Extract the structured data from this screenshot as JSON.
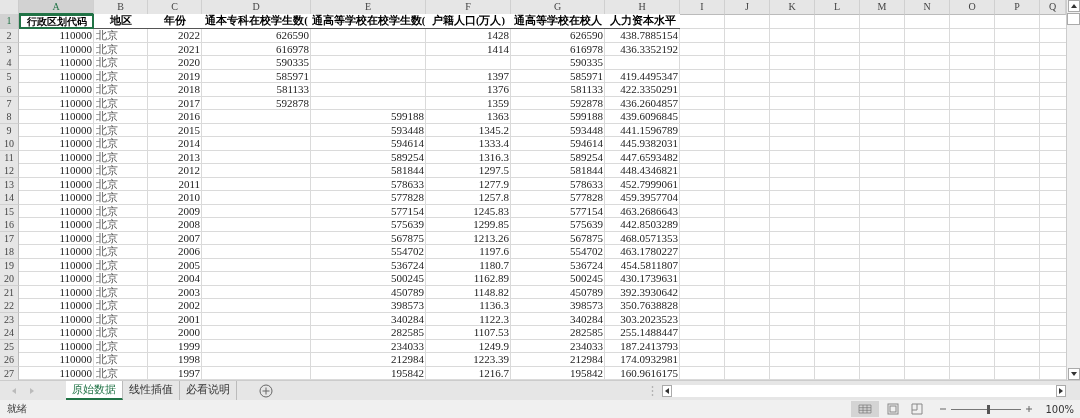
{
  "columns": [
    {
      "label": "A",
      "selected": true
    },
    {
      "label": "B",
      "selected": false
    },
    {
      "label": "C",
      "selected": false
    },
    {
      "label": "D",
      "selected": false
    },
    {
      "label": "E",
      "selected": false
    },
    {
      "label": "F",
      "selected": false
    },
    {
      "label": "G",
      "selected": false
    },
    {
      "label": "H",
      "selected": false
    },
    {
      "label": "I",
      "selected": false
    },
    {
      "label": "J",
      "selected": false
    },
    {
      "label": "K",
      "selected": false
    },
    {
      "label": "L",
      "selected": false
    },
    {
      "label": "M",
      "selected": false
    },
    {
      "label": "N",
      "selected": false
    },
    {
      "label": "O",
      "selected": false
    },
    {
      "label": "P",
      "selected": false
    },
    {
      "label": "Q",
      "selected": false
    }
  ],
  "rows": [
    {
      "number": "1",
      "selected": true,
      "cells": [
        "行政区划代码",
        "地区",
        "年份",
        "通本专科在校学生数(",
        "通高等学校在校学生数(",
        "户籍人口(万人)",
        "通高等学校在校人",
        "人力资本水平"
      ]
    },
    {
      "number": "2",
      "selected": false,
      "cells": [
        "110000",
        "北京",
        "2022",
        "626590",
        null,
        "1428",
        "626590",
        "438.7885154"
      ]
    },
    {
      "number": "3",
      "selected": false,
      "cells": [
        "110000",
        "北京",
        "2021",
        "616978",
        null,
        "1414",
        "616978",
        "436.3352192"
      ]
    },
    {
      "number": "4",
      "selected": false,
      "cells": [
        "110000",
        "北京",
        "2020",
        "590335",
        null,
        null,
        "590335",
        null
      ]
    },
    {
      "number": "5",
      "selected": false,
      "cells": [
        "110000",
        "北京",
        "2019",
        "585971",
        null,
        "1397",
        "585971",
        "419.4495347"
      ]
    },
    {
      "number": "6",
      "selected": false,
      "cells": [
        "110000",
        "北京",
        "2018",
        "581133",
        null,
        "1376",
        "581133",
        "422.3350291"
      ]
    },
    {
      "number": "7",
      "selected": false,
      "cells": [
        "110000",
        "北京",
        "2017",
        "592878",
        null,
        "1359",
        "592878",
        "436.2604857"
      ]
    },
    {
      "number": "8",
      "selected": false,
      "cells": [
        "110000",
        "北京",
        "2016",
        null,
        "599188",
        "1363",
        "599188",
        "439.6096845"
      ]
    },
    {
      "number": "9",
      "selected": false,
      "cells": [
        "110000",
        "北京",
        "2015",
        null,
        "593448",
        "1345.2",
        "593448",
        "441.1596789"
      ]
    },
    {
      "number": "10",
      "selected": false,
      "cells": [
        "110000",
        "北京",
        "2014",
        null,
        "594614",
        "1333.4",
        "594614",
        "445.9382031"
      ]
    },
    {
      "number": "11",
      "selected": false,
      "cells": [
        "110000",
        "北京",
        "2013",
        null,
        "589254",
        "1316.3",
        "589254",
        "447.6593482"
      ]
    },
    {
      "number": "12",
      "selected": false,
      "cells": [
        "110000",
        "北京",
        "2012",
        null,
        "581844",
        "1297.5",
        "581844",
        "448.4346821"
      ]
    },
    {
      "number": "13",
      "selected": false,
      "cells": [
        "110000",
        "北京",
        "2011",
        null,
        "578633",
        "1277.9",
        "578633",
        "452.7999061"
      ]
    },
    {
      "number": "14",
      "selected": false,
      "cells": [
        "110000",
        "北京",
        "2010",
        null,
        "577828",
        "1257.8",
        "577828",
        "459.3957704"
      ]
    },
    {
      "number": "15",
      "selected": false,
      "cells": [
        "110000",
        "北京",
        "2009",
        null,
        "577154",
        "1245.83",
        "577154",
        "463.2686643"
      ]
    },
    {
      "number": "16",
      "selected": false,
      "cells": [
        "110000",
        "北京",
        "2008",
        null,
        "575639",
        "1299.85",
        "575639",
        "442.8503289"
      ]
    },
    {
      "number": "17",
      "selected": false,
      "cells": [
        "110000",
        "北京",
        "2007",
        null,
        "567875",
        "1213.26",
        "567875",
        "468.0571353"
      ]
    },
    {
      "number": "18",
      "selected": false,
      "cells": [
        "110000",
        "北京",
        "2006",
        null,
        "554702",
        "1197.6",
        "554702",
        "463.1780227"
      ]
    },
    {
      "number": "19",
      "selected": false,
      "cells": [
        "110000",
        "北京",
        "2005",
        null,
        "536724",
        "1180.7",
        "536724",
        "454.5811807"
      ]
    },
    {
      "number": "20",
      "selected": false,
      "cells": [
        "110000",
        "北京",
        "2004",
        null,
        "500245",
        "1162.89",
        "500245",
        "430.1739631"
      ]
    },
    {
      "number": "21",
      "selected": false,
      "cells": [
        "110000",
        "北京",
        "2003",
        null,
        "450789",
        "1148.82",
        "450789",
        "392.3930642"
      ]
    },
    {
      "number": "22",
      "selected": false,
      "cells": [
        "110000",
        "北京",
        "2002",
        null,
        "398573",
        "1136.3",
        "398573",
        "350.7638828"
      ]
    },
    {
      "number": "23",
      "selected": false,
      "cells": [
        "110000",
        "北京",
        "2001",
        null,
        "340284",
        "1122.3",
        "340284",
        "303.2023523"
      ]
    },
    {
      "number": "24",
      "selected": false,
      "cells": [
        "110000",
        "北京",
        "2000",
        null,
        "282585",
        "1107.53",
        "282585",
        "255.1488447"
      ]
    },
    {
      "number": "25",
      "selected": false,
      "cells": [
        "110000",
        "北京",
        "1999",
        null,
        "234033",
        "1249.9",
        "234033",
        "187.2413793"
      ]
    },
    {
      "number": "26",
      "selected": false,
      "cells": [
        "110000",
        "北京",
        "1998",
        null,
        "212984",
        "1223.39",
        "212984",
        "174.0932981"
      ]
    },
    {
      "number": "27",
      "selected": false,
      "cells": [
        "110000",
        "北京",
        "1997",
        null,
        "195842",
        "1216.7",
        "195842",
        "160.9616175"
      ]
    }
  ],
  "sheet_tabs": [
    {
      "label": "原始数据",
      "selected": true
    },
    {
      "label": "线性插值",
      "selected": false
    },
    {
      "label": "必看说明",
      "selected": false
    }
  ],
  "status_bar": {
    "status": "就绪",
    "zoom": {
      "level": 0.52
    },
    "zoom_label": "100%"
  }
}
